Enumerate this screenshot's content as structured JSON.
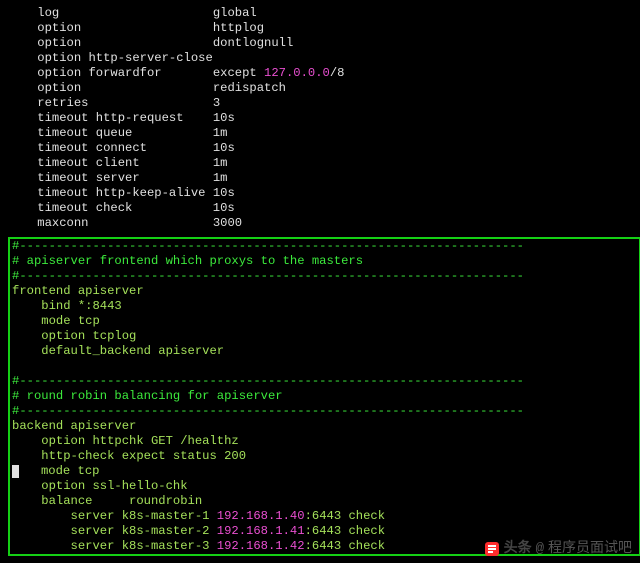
{
  "defaults": [
    {
      "key": "log",
      "value": "global"
    },
    {
      "key": "option",
      "value": "httplog"
    },
    {
      "key": "option",
      "value": "dontlognull"
    },
    {
      "key": "option http-server-close",
      "value": ""
    },
    {
      "key": "option forwardfor",
      "value": "except ",
      "ip": "127.0.0.0",
      "cidr": "/8"
    },
    {
      "key": "option",
      "value": "redispatch"
    },
    {
      "key": "retries",
      "value": "3"
    },
    {
      "key": "timeout http-request",
      "value": "10s"
    },
    {
      "key": "timeout queue",
      "value": "1m"
    },
    {
      "key": "timeout connect",
      "value": "10s"
    },
    {
      "key": "timeout client",
      "value": "1m"
    },
    {
      "key": "timeout server",
      "value": "1m"
    },
    {
      "key": "timeout http-keep-alive",
      "value": "10s"
    },
    {
      "key": "timeout check",
      "value": "10s"
    },
    {
      "key": "maxconn",
      "value": "3000"
    }
  ],
  "sep": "#---------------------------------------------------------------------",
  "comment1": "# apiserver frontend which proxys to the masters",
  "frontend": {
    "decl": "frontend apiserver",
    "lines": [
      "bind *:8443",
      "mode tcp",
      "option tcplog",
      "default_backend apiserver"
    ]
  },
  "comment2": "# round robin balancing for apiserver",
  "backend": {
    "decl": "backend apiserver",
    "lines_plain": [
      "option httpchk GET /healthz",
      "http-check expect status 200"
    ],
    "line_cursor": "mode tcp",
    "option_ssl": "option ssl-hello-chk",
    "balance": {
      "key": "balance",
      "value": "roundrobin"
    },
    "servers": [
      {
        "prefix": "server k8s-master-1 ",
        "ip": "192.168.1.40",
        "port": ":6443 check"
      },
      {
        "prefix": "server k8s-master-2 ",
        "ip": "192.168.1.41",
        "port": ":6443 check"
      },
      {
        "prefix": "server k8s-master-3 ",
        "ip": "192.168.1.42",
        "port": ":6443 check"
      }
    ]
  },
  "footer": {
    "brand": "头条",
    "at": "@",
    "name": "程序员面试吧"
  }
}
